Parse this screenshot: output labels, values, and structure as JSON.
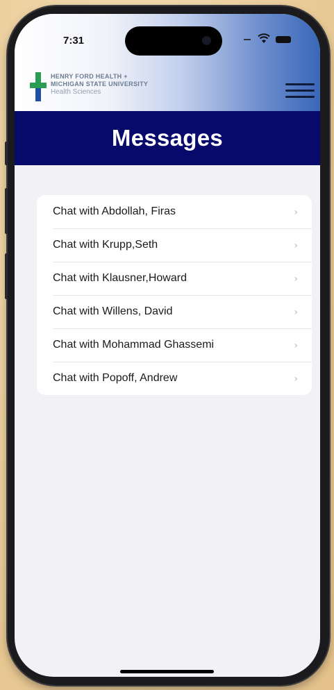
{
  "status_bar": {
    "time": "7:31",
    "icons": [
      "signal-dash-icon",
      "wifi-icon",
      "battery-icon"
    ]
  },
  "header": {
    "logo_line1": "HENRY FORD HEALTH +",
    "logo_line2": "MICHIGAN STATE UNIVERSITY",
    "logo_line3": "Health Sciences",
    "menu_icon": "hamburger-menu-icon"
  },
  "page": {
    "title": "Messages"
  },
  "chats": [
    {
      "label": "Chat with Abdollah, Firas"
    },
    {
      "label": "Chat with Krupp,Seth"
    },
    {
      "label": "Chat with Klausner,Howard"
    },
    {
      "label": "Chat with Willens, David"
    },
    {
      "label": "Chat with Mohammad Ghassemi"
    },
    {
      "label": "Chat with Popoff, Andrew"
    }
  ],
  "colors": {
    "title_bar": "#080a6b",
    "background": "#f1f1f6",
    "logo_green": "#2a9c54",
    "logo_blue": "#1f4fa3"
  }
}
